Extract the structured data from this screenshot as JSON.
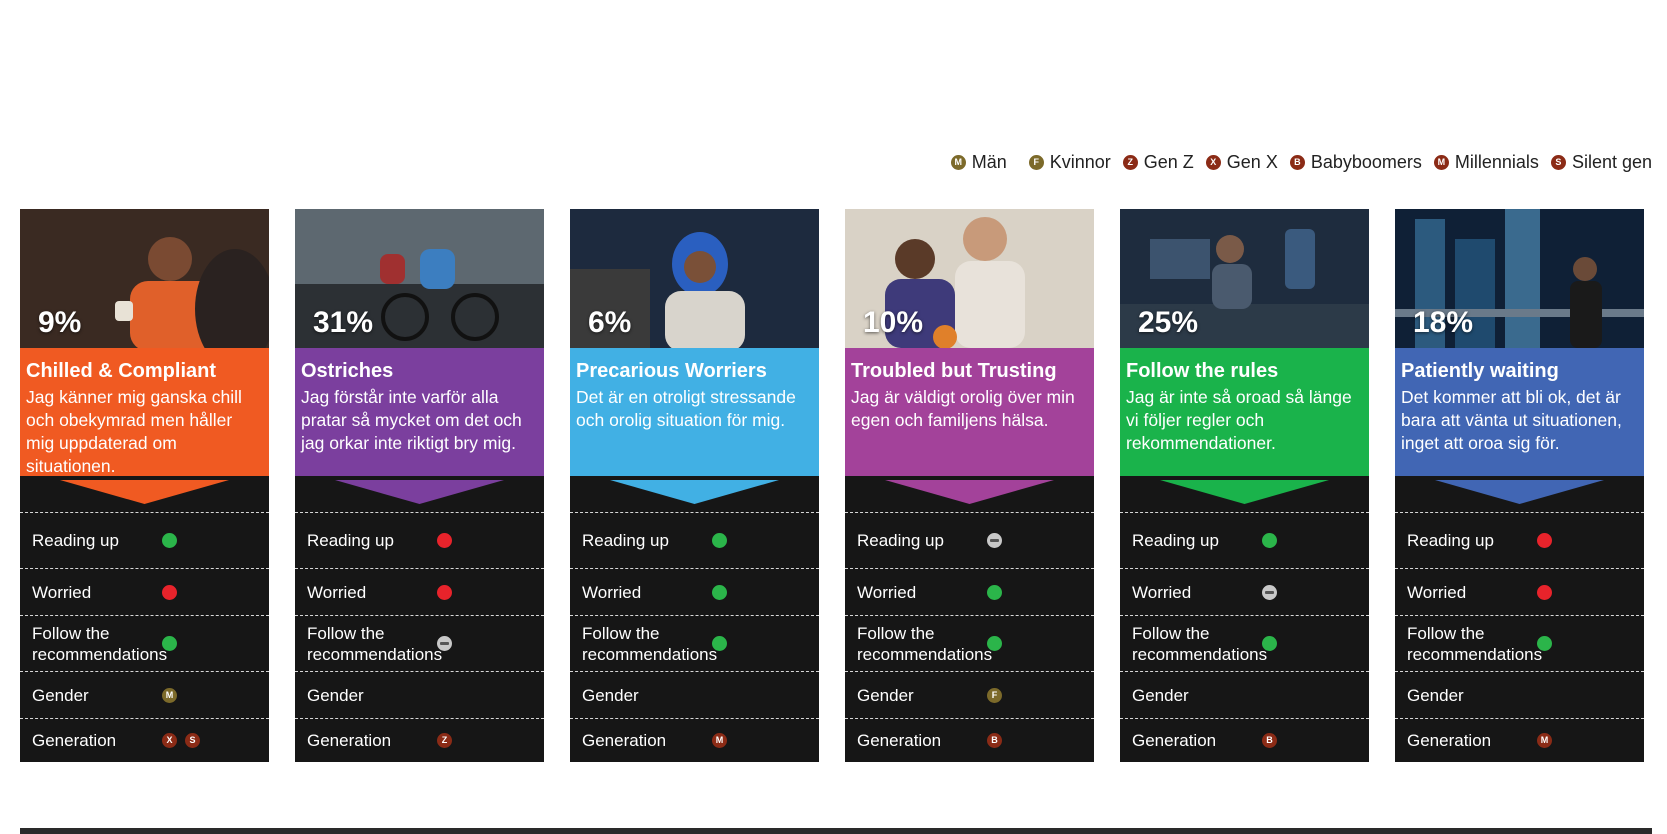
{
  "colors": {
    "green": "#2bb54a",
    "red": "#e8232b",
    "neutral": "#c8c8c8",
    "olive": "#7c6a2a",
    "maroon": "#8b2b16"
  },
  "legend": [
    {
      "letter": "M",
      "label": "Män",
      "color": "#7c6a2a"
    },
    {
      "letter": "F",
      "label": "Kvinnor",
      "color": "#7c6a2a"
    },
    {
      "letter": "Z",
      "label": "Gen Z",
      "color": "#8b2b16"
    },
    {
      "letter": "X",
      "label": "Gen X",
      "color": "#8b2b16"
    },
    {
      "letter": "B",
      "label": "Babyboomers",
      "color": "#8b2b16"
    },
    {
      "letter": "M",
      "label": "Millennials",
      "color": "#8b2b16"
    },
    {
      "letter": "S",
      "label": "Silent gen",
      "color": "#8b2b16"
    }
  ],
  "row_labels": {
    "reading": "Reading up",
    "worried": "Worried",
    "follow": "Follow the recommendations",
    "gender": "Gender",
    "generation": "Generation"
  },
  "cards": [
    {
      "percent": "9%",
      "title": "Chilled & Compliant",
      "quote": "Jag känner mig ganska chill och obekymrad men håller mig uppdaterad om situationen.",
      "color": "#f05a22",
      "reading": "green",
      "worried": "red",
      "follow": "green",
      "gender": [
        "M"
      ],
      "generation": [
        "X",
        "S"
      ]
    },
    {
      "percent": "31%",
      "title": "Ostriches",
      "quote": "Jag förstår inte varför alla pratar så mycket om det och jag orkar inte riktigt bry mig.",
      "color": "#7b3f9e",
      "reading": "red",
      "worried": "red",
      "follow": "neutral",
      "gender": [],
      "generation": [
        "Z"
      ]
    },
    {
      "percent": "6%",
      "title": "Precarious Worriers",
      "quote": "Det är en otroligt stressande och orolig situation för mig.",
      "color": "#41b0e4",
      "reading": "green",
      "worried": "green",
      "follow": "green",
      "gender": [],
      "generation": [
        "M"
      ]
    },
    {
      "percent": "10%",
      "title": "Troubled but Trusting",
      "quote": "Jag är väldigt orolig över min egen och familjens hälsa.",
      "color": "#a3429a",
      "reading": "neutral",
      "worried": "green",
      "follow": "green",
      "gender": [
        "F"
      ],
      "generation": [
        "B"
      ]
    },
    {
      "percent": "25%",
      "title": "Follow the rules",
      "quote": "Jag är inte så oroad så länge vi följer regler och rekommendationer.",
      "color": "#1ab34b",
      "reading": "green",
      "worried": "neutral",
      "follow": "green",
      "gender": [],
      "generation": [
        "B"
      ]
    },
    {
      "percent": "18%",
      "title": "Patiently waiting",
      "quote": "Det kommer att bli ok, det är bara att vänta ut situationen, inget att oroa sig för.",
      "color": "#4166b4",
      "reading": "red",
      "worried": "red",
      "follow": "green",
      "gender": [],
      "generation": [
        "M"
      ]
    }
  ]
}
